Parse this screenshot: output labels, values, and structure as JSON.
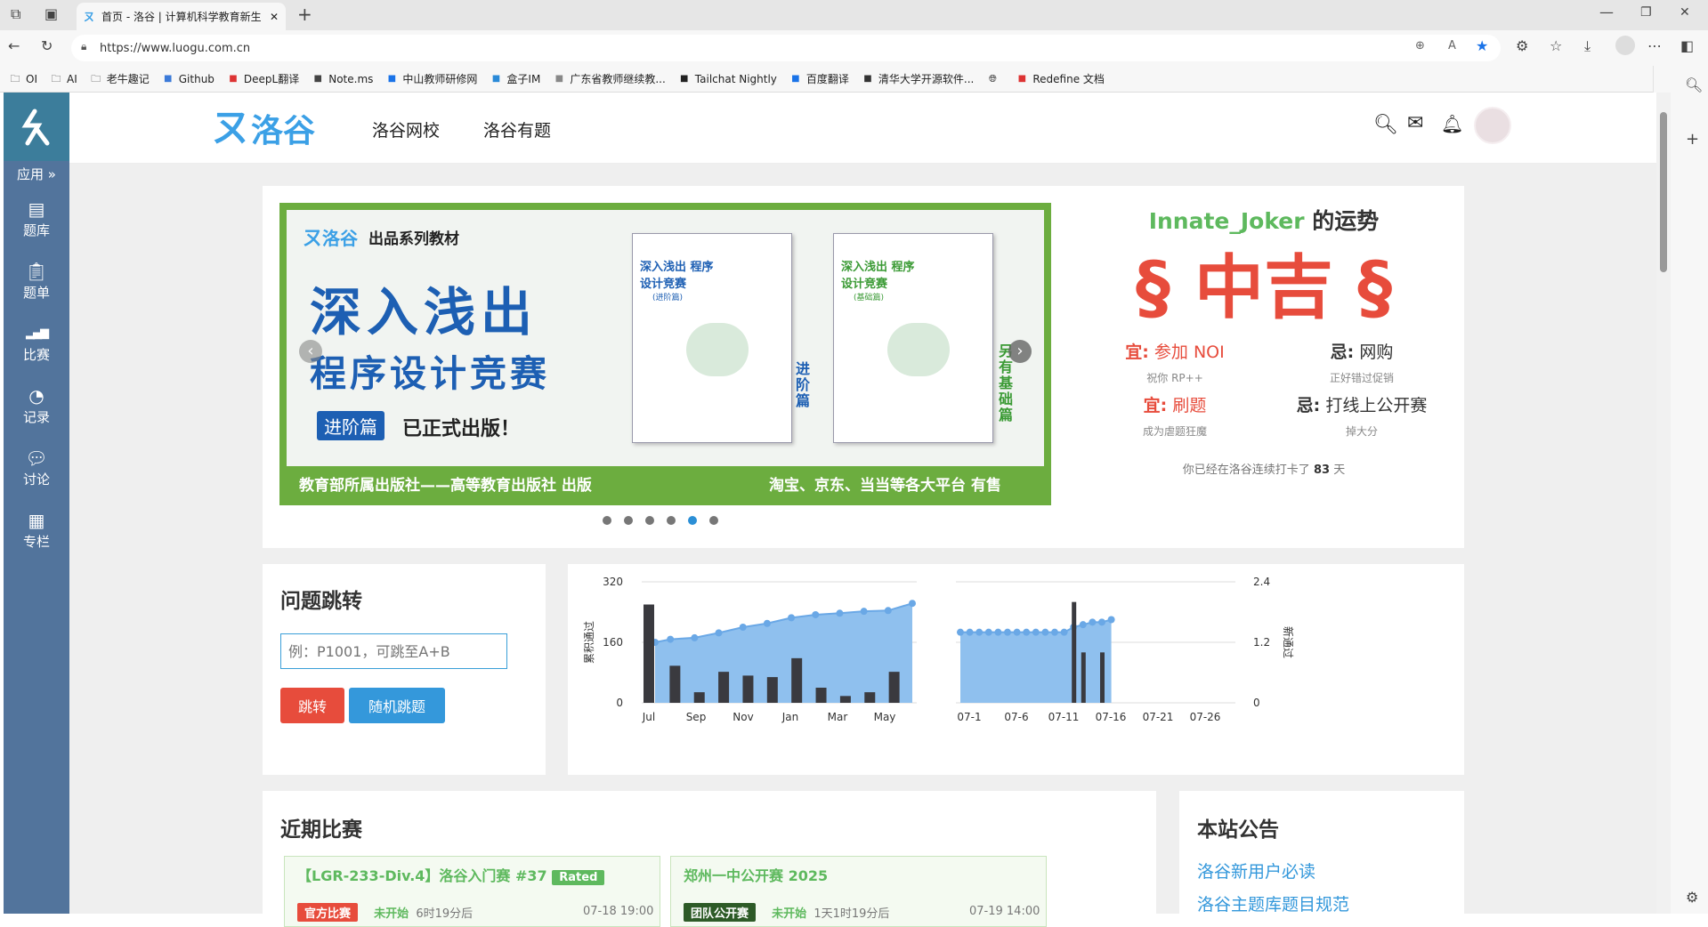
{
  "browser": {
    "tab_title": "首页 - 洛谷 | 计算机科学教育新生",
    "url": "https://www.luogu.com.cn",
    "bookmarks": [
      {
        "label": "OI",
        "icon": "folder-icon"
      },
      {
        "label": "AI",
        "icon": "folder-icon"
      },
      {
        "label": "老牛趣记",
        "icon": "folder-icon"
      },
      {
        "label": "Github",
        "icon": "github-icon"
      },
      {
        "label": "DeepL翻译",
        "icon": "deepl-icon"
      },
      {
        "label": "Note.ms",
        "icon": "note-icon"
      },
      {
        "label": "中山教师研修网",
        "icon": "site-icon"
      },
      {
        "label": "盒子IM",
        "icon": "box-icon"
      },
      {
        "label": "广东省教师继续教...",
        "icon": "site-icon"
      },
      {
        "label": "Tailchat Nightly",
        "icon": "tailchat-icon"
      },
      {
        "label": "百度翻译",
        "icon": "translate-icon"
      },
      {
        "label": "清华大学开源软件...",
        "icon": "tsinghua-icon"
      },
      {
        "label": "",
        "icon": "globe-icon"
      },
      {
        "label": "Redefine 文档",
        "icon": "doc-icon"
      }
    ]
  },
  "sidebar": {
    "apps_label": "应用 »",
    "items": [
      {
        "label": "题库",
        "icon": "book-icon"
      },
      {
        "label": "题单",
        "icon": "clipboard-icon"
      },
      {
        "label": "比赛",
        "icon": "bar-chart-icon"
      },
      {
        "label": "记录",
        "icon": "pie-chart-icon"
      },
      {
        "label": "讨论",
        "icon": "chat-icon"
      },
      {
        "label": "专栏",
        "icon": "newspaper-icon"
      }
    ]
  },
  "header": {
    "logo_text": "洛谷",
    "nav": [
      "洛谷网校",
      "洛谷有题"
    ]
  },
  "banner": {
    "brand": "洛谷",
    "series": "出品系列教材",
    "title_line1": "深入浅出",
    "title_line2": "程序设计竞赛",
    "badge": "进阶篇",
    "published": "已正式出版！",
    "book1_title": "深入浅出 程序设计竞赛",
    "book1_sub": "(进阶篇)",
    "book1_side": "进阶篇",
    "book2_title": "深入浅出 程序设计竞赛",
    "book2_sub": "(基础篇)",
    "book2_side": "另有基础篇",
    "footer_left": "教育部所属出版社——高等教育出版社 出版",
    "footer_right": "淘宝、京东、当当等各大平台 有售",
    "active_dot": 5,
    "dot_count": 6
  },
  "fortune": {
    "username": "Innate_Joker",
    "title_suffix": "的运势",
    "result": "§ 中吉 §",
    "good": [
      {
        "label": "宜:",
        "item": "参加 NOI",
        "note": "祝你 RP++"
      },
      {
        "label": "宜:",
        "item": "刷题",
        "note": "成为虐题狂魔"
      }
    ],
    "bad": [
      {
        "label": "忌:",
        "item": "网购",
        "note": "正好错过促销"
      },
      {
        "label": "忌:",
        "item": "打线上公开赛",
        "note": "掉大分"
      }
    ],
    "streak_prefix": "你已经在洛谷连续打卡了",
    "streak_days": "83",
    "streak_suffix": "天"
  },
  "jump": {
    "title": "问题跳转",
    "placeholder": "例：P1001，可跳至A+B",
    "jump_btn": "跳转",
    "random_btn": "随机跳题"
  },
  "chart_data": [
    {
      "type": "bar+area",
      "ylabel_left": "累积通过",
      "yticks_left": [
        "320",
        "160",
        "0"
      ],
      "xticks": [
        "Jul",
        "Sep",
        "Nov",
        "Jan",
        "Mar",
        "May"
      ],
      "bars": [
        260,
        98,
        28,
        82,
        72,
        68,
        118,
        40,
        18,
        28,
        82
      ],
      "area": [
        160,
        168,
        172,
        185,
        200,
        210,
        225,
        233,
        237,
        242,
        244,
        263
      ],
      "ylim": [
        0,
        320
      ]
    },
    {
      "type": "bar+area",
      "ylabel_right": "新通过",
      "yticks_right": [
        "2.4",
        "1.2",
        "0"
      ],
      "xticks": [
        "07-1",
        "07-6",
        "07-11",
        "07-16",
        "07-21",
        "07-26"
      ],
      "area": [
        1.4,
        1.4,
        1.4,
        1.4,
        1.4,
        1.4,
        1.4,
        1.4,
        1.4,
        1.4,
        1.4,
        1.4,
        1.5,
        1.55,
        1.6,
        1.6,
        1.65
      ],
      "bars": [
        {
          "x": 12,
          "v": 2.0
        },
        {
          "x": 13,
          "v": 1.0
        },
        {
          "x": 15,
          "v": 1.0
        }
      ],
      "ylim": [
        0,
        2.4
      ]
    }
  ],
  "contests": {
    "title": "近期比赛",
    "items": [
      {
        "name": "【LGR-233-Div.4】洛谷入门赛 #37",
        "tag": "Rated",
        "type": "官方比赛",
        "status": "未开始",
        "countdown": "6时19分后",
        "time": "07-18 19:00"
      },
      {
        "name": "郑州一中公开赛 2025",
        "tag": "",
        "type": "团队公开赛",
        "status": "未开始",
        "countdown": "1天1时19分后",
        "time": "07-19 14:00"
      }
    ]
  },
  "notice": {
    "title": "本站公告",
    "links": [
      "洛谷新用户必读",
      "洛谷主题库题目规范"
    ]
  }
}
